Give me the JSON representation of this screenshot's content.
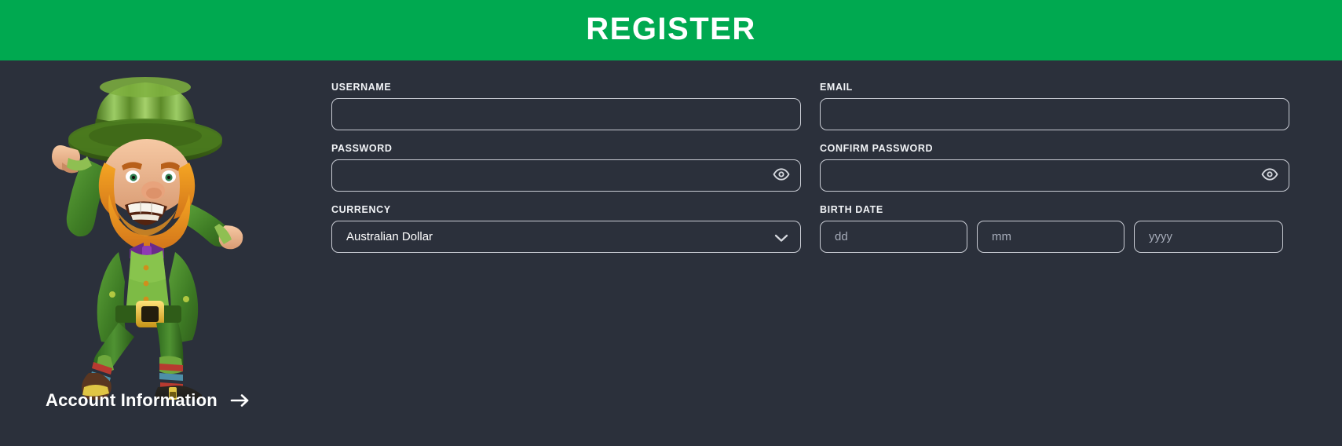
{
  "header": {
    "title": "REGISTER",
    "background_color": "#00a950"
  },
  "theme": {
    "page_background": "#2b303b",
    "input_border": "#c9ccd4",
    "text_color": "#ffffff",
    "placeholder_color": "#a7adba"
  },
  "mascot": {
    "name": "leprechaun-mascot",
    "description": "Cartoon leprechaun with green top hat, orange beard and green suit"
  },
  "footer": {
    "account_information_label": "Account Information",
    "arrow_icon": "arrow-right-icon"
  },
  "form": {
    "fields": {
      "username": {
        "label": "USERNAME",
        "value": "",
        "placeholder": ""
      },
      "email": {
        "label": "EMAIL",
        "value": "",
        "placeholder": ""
      },
      "password": {
        "label": "PASSWORD",
        "value": "",
        "placeholder": "",
        "toggle_icon": "eye-icon"
      },
      "confirm_password": {
        "label": "CONFIRM PASSWORD",
        "value": "",
        "placeholder": "",
        "toggle_icon": "eye-icon"
      },
      "currency": {
        "label": "CURRENCY",
        "selected": "Australian Dollar",
        "chevron_icon": "chevron-down-icon"
      },
      "birth_date": {
        "label": "BIRTH DATE",
        "day": {
          "placeholder": "dd",
          "value": ""
        },
        "month": {
          "placeholder": "mm",
          "value": ""
        },
        "year": {
          "placeholder": "yyyy",
          "value": ""
        }
      }
    }
  }
}
